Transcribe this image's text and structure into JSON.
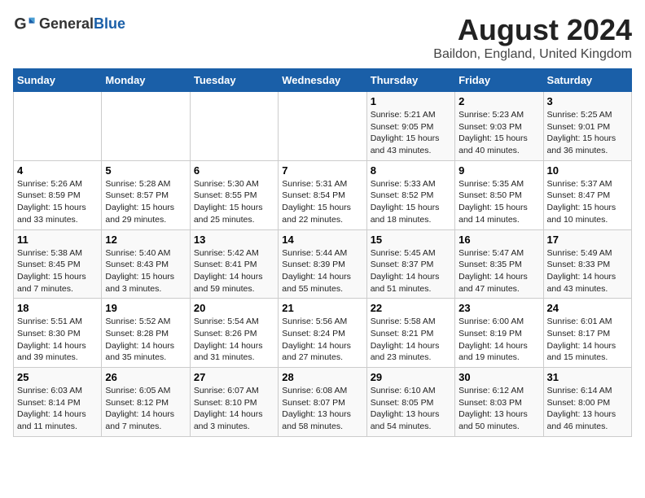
{
  "header": {
    "logo_general": "General",
    "logo_blue": "Blue",
    "title": "August 2024",
    "subtitle": "Baildon, England, United Kingdom"
  },
  "days_of_week": [
    "Sunday",
    "Monday",
    "Tuesday",
    "Wednesday",
    "Thursday",
    "Friday",
    "Saturday"
  ],
  "weeks": [
    [
      {
        "day": "",
        "info": ""
      },
      {
        "day": "",
        "info": ""
      },
      {
        "day": "",
        "info": ""
      },
      {
        "day": "",
        "info": ""
      },
      {
        "day": "1",
        "info": "Sunrise: 5:21 AM\nSunset: 9:05 PM\nDaylight: 15 hours\nand 43 minutes."
      },
      {
        "day": "2",
        "info": "Sunrise: 5:23 AM\nSunset: 9:03 PM\nDaylight: 15 hours\nand 40 minutes."
      },
      {
        "day": "3",
        "info": "Sunrise: 5:25 AM\nSunset: 9:01 PM\nDaylight: 15 hours\nand 36 minutes."
      }
    ],
    [
      {
        "day": "4",
        "info": "Sunrise: 5:26 AM\nSunset: 8:59 PM\nDaylight: 15 hours\nand 33 minutes."
      },
      {
        "day": "5",
        "info": "Sunrise: 5:28 AM\nSunset: 8:57 PM\nDaylight: 15 hours\nand 29 minutes."
      },
      {
        "day": "6",
        "info": "Sunrise: 5:30 AM\nSunset: 8:55 PM\nDaylight: 15 hours\nand 25 minutes."
      },
      {
        "day": "7",
        "info": "Sunrise: 5:31 AM\nSunset: 8:54 PM\nDaylight: 15 hours\nand 22 minutes."
      },
      {
        "day": "8",
        "info": "Sunrise: 5:33 AM\nSunset: 8:52 PM\nDaylight: 15 hours\nand 18 minutes."
      },
      {
        "day": "9",
        "info": "Sunrise: 5:35 AM\nSunset: 8:50 PM\nDaylight: 15 hours\nand 14 minutes."
      },
      {
        "day": "10",
        "info": "Sunrise: 5:37 AM\nSunset: 8:47 PM\nDaylight: 15 hours\nand 10 minutes."
      }
    ],
    [
      {
        "day": "11",
        "info": "Sunrise: 5:38 AM\nSunset: 8:45 PM\nDaylight: 15 hours\nand 7 minutes."
      },
      {
        "day": "12",
        "info": "Sunrise: 5:40 AM\nSunset: 8:43 PM\nDaylight: 15 hours\nand 3 minutes."
      },
      {
        "day": "13",
        "info": "Sunrise: 5:42 AM\nSunset: 8:41 PM\nDaylight: 14 hours\nand 59 minutes."
      },
      {
        "day": "14",
        "info": "Sunrise: 5:44 AM\nSunset: 8:39 PM\nDaylight: 14 hours\nand 55 minutes."
      },
      {
        "day": "15",
        "info": "Sunrise: 5:45 AM\nSunset: 8:37 PM\nDaylight: 14 hours\nand 51 minutes."
      },
      {
        "day": "16",
        "info": "Sunrise: 5:47 AM\nSunset: 8:35 PM\nDaylight: 14 hours\nand 47 minutes."
      },
      {
        "day": "17",
        "info": "Sunrise: 5:49 AM\nSunset: 8:33 PM\nDaylight: 14 hours\nand 43 minutes."
      }
    ],
    [
      {
        "day": "18",
        "info": "Sunrise: 5:51 AM\nSunset: 8:30 PM\nDaylight: 14 hours\nand 39 minutes."
      },
      {
        "day": "19",
        "info": "Sunrise: 5:52 AM\nSunset: 8:28 PM\nDaylight: 14 hours\nand 35 minutes."
      },
      {
        "day": "20",
        "info": "Sunrise: 5:54 AM\nSunset: 8:26 PM\nDaylight: 14 hours\nand 31 minutes."
      },
      {
        "day": "21",
        "info": "Sunrise: 5:56 AM\nSunset: 8:24 PM\nDaylight: 14 hours\nand 27 minutes."
      },
      {
        "day": "22",
        "info": "Sunrise: 5:58 AM\nSunset: 8:21 PM\nDaylight: 14 hours\nand 23 minutes."
      },
      {
        "day": "23",
        "info": "Sunrise: 6:00 AM\nSunset: 8:19 PM\nDaylight: 14 hours\nand 19 minutes."
      },
      {
        "day": "24",
        "info": "Sunrise: 6:01 AM\nSunset: 8:17 PM\nDaylight: 14 hours\nand 15 minutes."
      }
    ],
    [
      {
        "day": "25",
        "info": "Sunrise: 6:03 AM\nSunset: 8:14 PM\nDaylight: 14 hours\nand 11 minutes."
      },
      {
        "day": "26",
        "info": "Sunrise: 6:05 AM\nSunset: 8:12 PM\nDaylight: 14 hours\nand 7 minutes."
      },
      {
        "day": "27",
        "info": "Sunrise: 6:07 AM\nSunset: 8:10 PM\nDaylight: 14 hours\nand 3 minutes."
      },
      {
        "day": "28",
        "info": "Sunrise: 6:08 AM\nSunset: 8:07 PM\nDaylight: 13 hours\nand 58 minutes."
      },
      {
        "day": "29",
        "info": "Sunrise: 6:10 AM\nSunset: 8:05 PM\nDaylight: 13 hours\nand 54 minutes."
      },
      {
        "day": "30",
        "info": "Sunrise: 6:12 AM\nSunset: 8:03 PM\nDaylight: 13 hours\nand 50 minutes."
      },
      {
        "day": "31",
        "info": "Sunrise: 6:14 AM\nSunset: 8:00 PM\nDaylight: 13 hours\nand 46 minutes."
      }
    ]
  ]
}
